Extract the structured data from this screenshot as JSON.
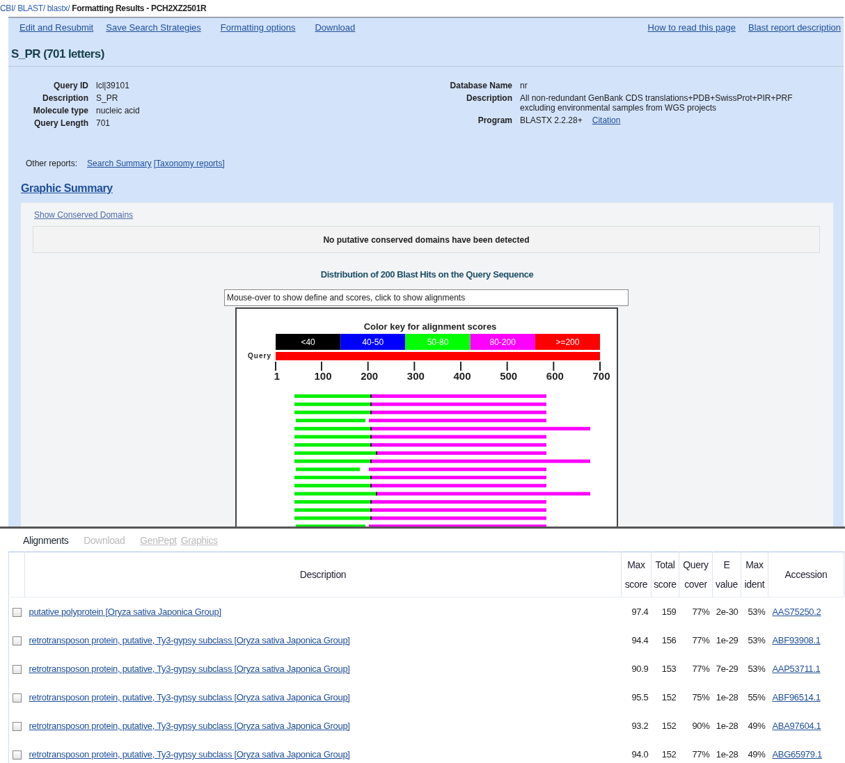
{
  "breadcrumb": [
    {
      "text": "CBI/",
      "kind": "link"
    },
    {
      "text": "BLAST/",
      "kind": "link"
    },
    {
      "text": "blastx/",
      "kind": "link"
    },
    {
      "text": "Formatting Results - PCH2XZ2501R",
      "kind": "current"
    }
  ],
  "nav_links": [
    "Edit and Resubmit",
    "Save Search Strategies",
    "Formatting options",
    "Download"
  ],
  "help_links": [
    "How to read this page",
    "Blast report description"
  ],
  "query_title": "S_PR (701 letters)",
  "query_info": [
    {
      "label": "Query ID",
      "value": "lcl|39101"
    },
    {
      "label": "Description",
      "value": "S_PR"
    },
    {
      "label": "Molecule type",
      "value": "nucleic acid"
    },
    {
      "label": "Query Length",
      "value": "701"
    }
  ],
  "database_info": [
    {
      "label": "Database Name",
      "value": "nr"
    },
    {
      "label": "Description",
      "value": "All non-redundant GenBank CDS translations+PDB+SwissProt+PIR+PRF excluding environmental samples from WGS projects"
    },
    {
      "label": "Program",
      "value": "BLASTX 2.2.28+",
      "link": "Citation"
    }
  ],
  "other_reports": {
    "label": "Other reports:",
    "links": [
      "Search Summary",
      "[Taxonomy reports]"
    ]
  },
  "graphic_summary": {
    "title": "Graphic Summary",
    "conserved_link": "Show Conserved Domains",
    "conserved_message": "No putative conserved domains have been detected",
    "distribution_title": "Distribution of 200 Blast Hits on the Query Sequence",
    "mouseover_field": "Mouse-over to show define and scores, click to show alignments",
    "key_title": "Color key for alignment scores",
    "color_key": [
      {
        "label": "<40",
        "color": "#000000"
      },
      {
        "label": "40-50",
        "color": "#0000ff"
      },
      {
        "label": "50-80",
        "color": "#00ff00"
      },
      {
        "label": "80-200",
        "color": "#ff00ff"
      },
      {
        "label": ">=200",
        "color": "#ff0000"
      }
    ],
    "query_label": "Query",
    "axis_ticks": [
      "1",
      "100",
      "200",
      "300",
      "400",
      "500",
      "600",
      "700"
    ]
  },
  "results_tabs": [
    {
      "label": "Alignments",
      "kind": "tab",
      "selected": true,
      "disabled": false
    },
    {
      "label": "Download",
      "kind": "tab",
      "selected": false,
      "disabled": true
    },
    {
      "label": "GenPept",
      "kind": "link",
      "selected": false,
      "disabled": true
    },
    {
      "label": "Graphics",
      "kind": "link",
      "selected": false,
      "disabled": true
    }
  ],
  "table": {
    "columns": [
      "Description",
      "Max score",
      "Total score",
      "Query cover",
      "E value",
      "Max ident",
      "Accession"
    ],
    "rows": [
      {
        "checked": false,
        "description": "putative polyprotein [Oryza sativa Japonica Group]",
        "max_score": "97.4",
        "total_score": "159",
        "query_cover": "77%",
        "e_value": "2e-30",
        "max_ident": "53%",
        "accession": "AAS75250.2"
      },
      {
        "checked": false,
        "description": "retrotransposon protein, putative, Ty3-gypsy subclass [Oryza sativa Japonica Group]",
        "max_score": "94.4",
        "total_score": "156",
        "query_cover": "77%",
        "e_value": "1e-29",
        "max_ident": "53%",
        "accession": "ABF93908.1"
      },
      {
        "checked": false,
        "description": "retrotransposon protein, putative, Ty3-gypsy subclass [Oryza sativa Japonica Group]",
        "max_score": "90.9",
        "total_score": "153",
        "query_cover": "77%",
        "e_value": "7e-29",
        "max_ident": "53%",
        "accession": "AAP53711.1"
      },
      {
        "checked": false,
        "description": "retrotransposon protein, putative, Ty3-gypsy subclass [Oryza sativa Japonica Group]",
        "max_score": "95.5",
        "total_score": "152",
        "query_cover": "75%",
        "e_value": "1e-28",
        "max_ident": "55%",
        "accession": "ABF96514.1"
      },
      {
        "checked": false,
        "description": "retrotransposon protein, putative, Ty3-gypsy subclass [Oryza sativa Japonica Group]",
        "max_score": "93.2",
        "total_score": "152",
        "query_cover": "90%",
        "e_value": "1e-28",
        "max_ident": "49%",
        "accession": "ABA97604.1"
      },
      {
        "checked": false,
        "description": "retrotransposon protein, putative, Ty3-gypsy subclass [Oryza sativa Japonica Group]",
        "max_score": "94.0",
        "total_score": "152",
        "query_cover": "77%",
        "e_value": "1e-28",
        "max_ident": "49%",
        "accession": "ABG65979.1"
      }
    ]
  }
}
